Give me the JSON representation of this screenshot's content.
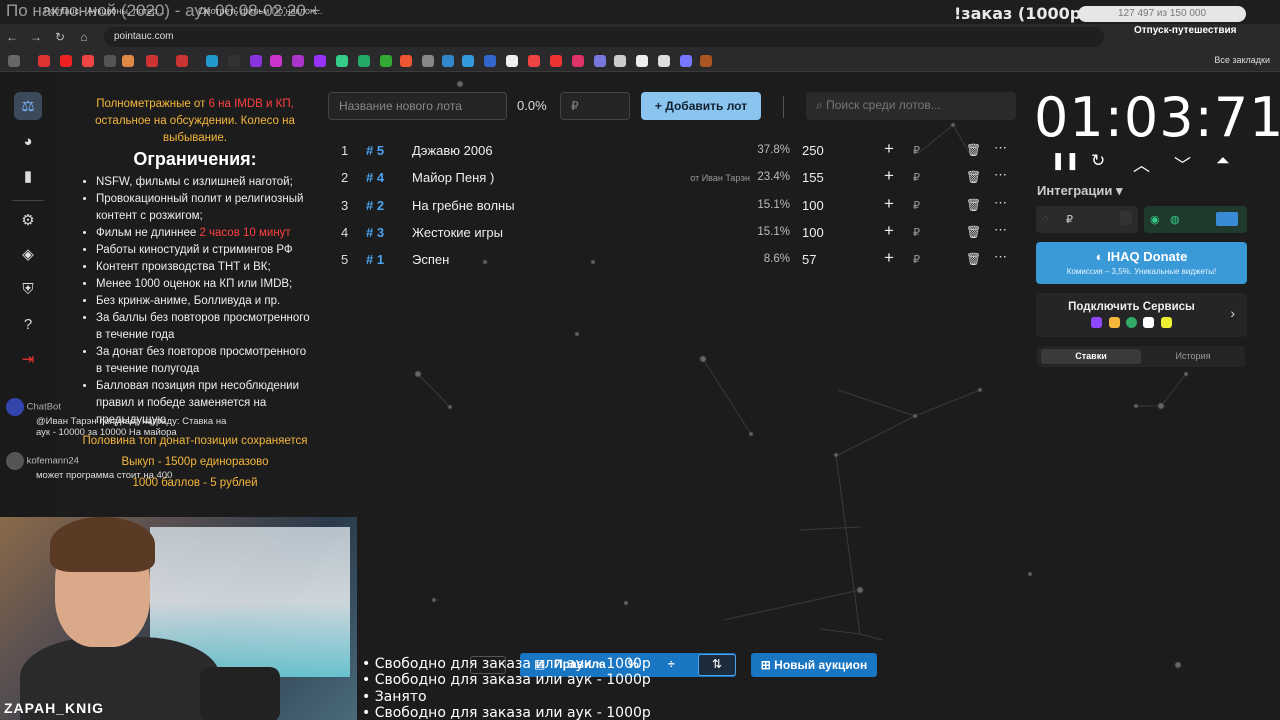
{
  "overlay": {
    "title": "По наклонной (2020) - аук 00:08-02:20 +",
    "order_text": "!заказ (1000р)",
    "progress_text": "127 497 из 150 000",
    "progress_fraction": 0.85,
    "vacation": "Отпуск-путешествия"
  },
  "browser": {
    "tabs": [
      "Pointauc - Аукционы, лотер...",
      "Смотреть фильм По наклон..."
    ],
    "url": "pointauc.com",
    "all_bookmarks": "Все закладки"
  },
  "rules": {
    "intro_orange_1": "Полнометражные от ",
    "intro_red": "6 на IMDB и КП,",
    "intro_orange_2": " остальное на обсуждении. Колесо на выбывание.",
    "heading": "Ограничения:",
    "items": [
      "NSFW, фильмы с излишней наготой;",
      "Провокационный полит и религиозный контент с розжигом;",
      "Фильм не длиннее ",
      "Работы киностудий и стримингов РФ",
      "Контент производства ТНТ и ВК;",
      "Менее 1000 оценок на КП или IMDB;",
      "Без кринж-аниме, Болливуда и пр.",
      "За баллы без повторов просмотренного в течение года",
      "За донат без повторов просмотренного в течение полугода",
      "Балловая позиция при несоблюдении правил и победе заменяется на предыдущую"
    ],
    "duration_red": "2 часов 10 минут",
    "half_top": "Половина топ донат-позиции сохраняется",
    "buyout": "Выкуп - 1500р единоразово",
    "points": "1000 баллов - 5 рублей"
  },
  "chat": {
    "bot_name": "ChatBot",
    "bot_msg": "@Иван Тарэн получает награду: Ставка на аук - 10000 за 10000 На майора",
    "user_name": "kofemann24",
    "user_msg": "может программа стоит на 400"
  },
  "webcam": {
    "name": "ZAPAH_KNIG"
  },
  "form": {
    "lot_placeholder": "Название нового лота",
    "percent": "0.0%",
    "currency": "₽",
    "add_label": "Добавить лот",
    "search_placeholder": "Поиск среди лотов..."
  },
  "lots": [
    {
      "idx": "1",
      "num": "# 5",
      "name": "Дэжавю 2006",
      "from": "",
      "pct": "37.8%",
      "amount": "250"
    },
    {
      "idx": "2",
      "num": "# 4",
      "name": "Майор Пеня )",
      "from": "от Иван Тарэн",
      "pct": "23.4%",
      "amount": "155"
    },
    {
      "idx": "3",
      "num": "# 2",
      "name": "На гребне волны",
      "from": "",
      "pct": "15.1%",
      "amount": "100"
    },
    {
      "idx": "4",
      "num": "# 3",
      "name": "Жестокие игры",
      "from": "",
      "pct": "15.1%",
      "amount": "100"
    },
    {
      "idx": "5",
      "num": "# 1",
      "name": "Эспен",
      "from": "",
      "pct": "8.6%",
      "amount": "57"
    }
  ],
  "timer": {
    "value": "01:03:71"
  },
  "right": {
    "integrations": "Интеграции",
    "donate_title": "IHAQ Donate",
    "donate_sub": "Комиссия – 3,5%. Уникальные виджеты!",
    "connect": "Подключить Сервисы",
    "tab_bets": "Ставки",
    "tab_history": "История"
  },
  "bottom": {
    "rules_btn": "Правила",
    "new_auction": "Новый аукцион",
    "orders": [
      "• Свободно для заказа или аук - 1000р",
      "• Свободно для заказа или аук - 1000р",
      "• Занято",
      "• Свободно для заказа или аук - 1000р"
    ]
  },
  "colors": {
    "accent": "#1976c2",
    "link": "#4aa3f0",
    "red": "#ff4040",
    "orange": "#f5b73b"
  }
}
